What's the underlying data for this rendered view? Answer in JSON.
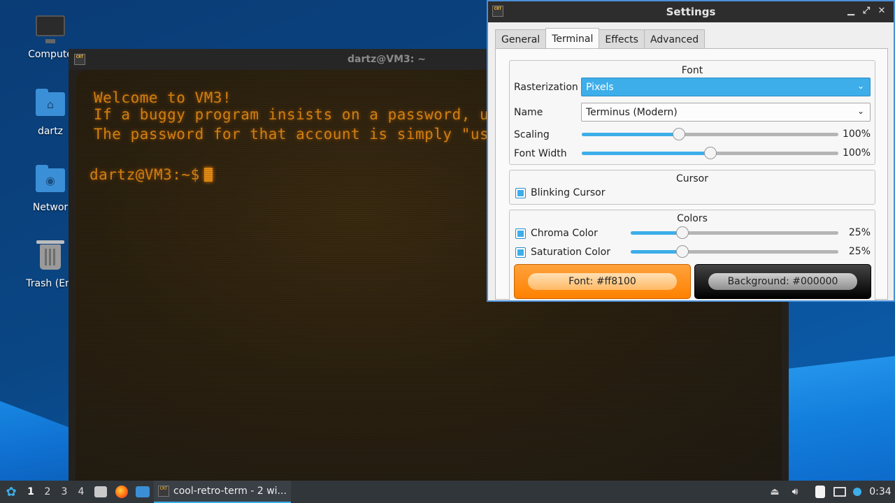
{
  "desktop": {
    "icons": [
      {
        "label": "Compute"
      },
      {
        "label": "dartz"
      },
      {
        "label": "Networ"
      },
      {
        "label": "Trash (Em"
      }
    ]
  },
  "terminal": {
    "title": "dartz@VM3: ~",
    "lines": [
      "Welcome to VM3!",
      "If a buggy program insists on a password, us",
      "The password for that account is simply \"us"
    ],
    "prompt": "dartz@VM3:~$"
  },
  "settings": {
    "title": "Settings",
    "icon_text": "CRT",
    "tabs": [
      "General",
      "Terminal",
      "Effects",
      "Advanced"
    ],
    "active_tab": "Terminal",
    "font_group": {
      "title": "Font",
      "rasterization_label": "Rasterization",
      "rasterization_value": "Pixels",
      "name_label": "Name",
      "name_value": "Terminus (Modern)",
      "scaling_label": "Scaling",
      "scaling_value": "100%",
      "scaling_fraction": 0.38,
      "font_width_label": "Font Width",
      "font_width_value": "100%",
      "font_width_fraction": 0.5
    },
    "cursor_group": {
      "title": "Cursor",
      "blinking_label": "Blinking Cursor",
      "blinking_checked": true
    },
    "colors_group": {
      "title": "Colors",
      "chroma_label": "Chroma Color",
      "chroma_value": "25%",
      "chroma_fraction": 0.25,
      "saturation_label": "Saturation Color",
      "saturation_value": "25%",
      "saturation_fraction": 0.25,
      "font_button": "Font:  #ff8100",
      "background_button": "Background:  #000000"
    }
  },
  "taskbar": {
    "workspaces": [
      "1",
      "2",
      "3",
      "4"
    ],
    "active_workspace": "1",
    "task_label": "cool-retro-term - 2 wi...",
    "clock": "0:34"
  },
  "colors": {
    "accent": "#3daee9",
    "terminal_font": "#ff8100",
    "terminal_background": "#000000"
  }
}
